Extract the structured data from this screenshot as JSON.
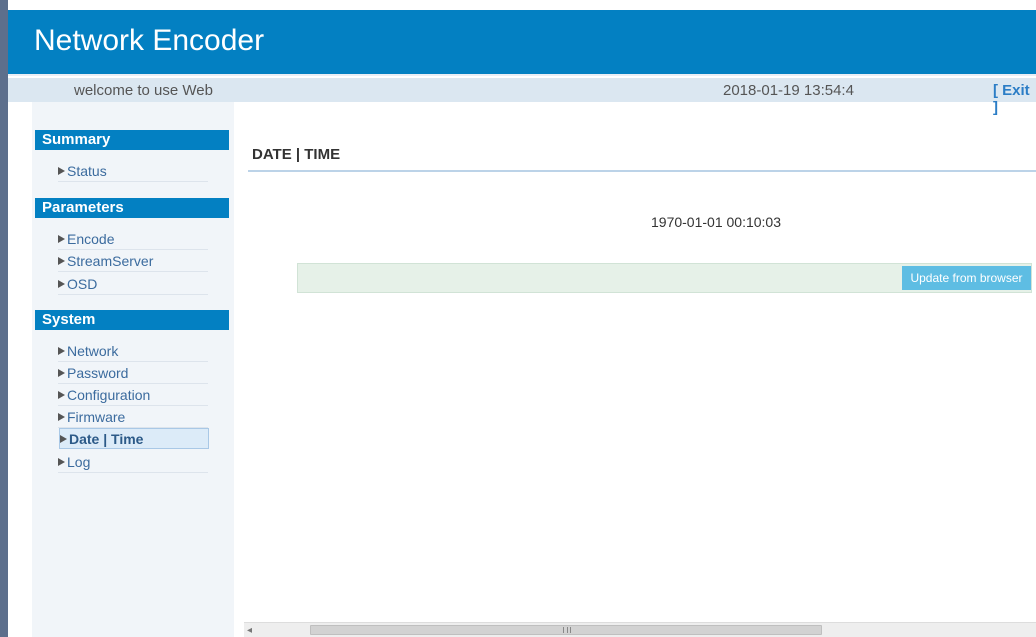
{
  "header": {
    "title": "Network Encoder"
  },
  "subbar": {
    "welcome": "welcome to use Web",
    "datetime": "2018-01-19 13:54:4",
    "exit": "[ Exit ]"
  },
  "sidebar": {
    "summary": {
      "title": "Summary",
      "items": [
        {
          "label": "Status"
        }
      ]
    },
    "parameters": {
      "title": "Parameters",
      "items": [
        {
          "label": "Encode"
        },
        {
          "label": "StreamServer"
        },
        {
          "label": "OSD"
        }
      ]
    },
    "system": {
      "title": "System",
      "items": [
        {
          "label": "Network"
        },
        {
          "label": "Password"
        },
        {
          "label": "Configuration"
        },
        {
          "label": "Firmware"
        },
        {
          "label": "Date | Time"
        },
        {
          "label": "Log"
        }
      ],
      "active": "Date | Time"
    }
  },
  "main": {
    "title": "DATE | TIME",
    "device_time": "1970-01-01 00:10:03",
    "update_button": "Update from browser"
  },
  "icons": {
    "nav_arrow": "triangle-right-icon",
    "scroll_left": "scroll-left-arrow-icon"
  },
  "colors": {
    "accent": "#0380c2",
    "button": "#5ebde3",
    "action_bar": "#e6f1e8"
  }
}
